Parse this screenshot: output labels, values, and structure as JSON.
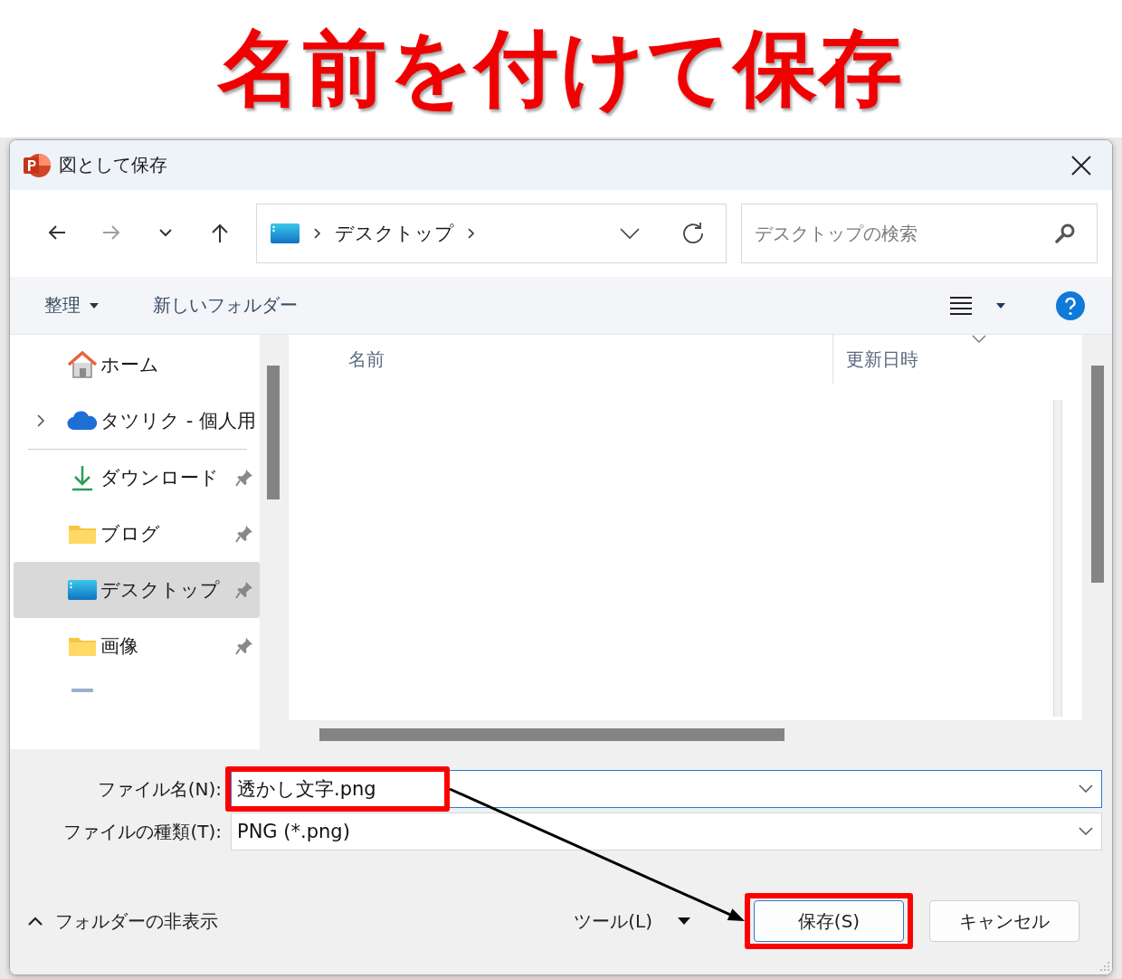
{
  "banner": {
    "title": "名前を付けて保存"
  },
  "window": {
    "title": "図として保存"
  },
  "nav_buttons": [
    {
      "kind": "back",
      "disabled": false
    },
    {
      "kind": "forward",
      "disabled": true
    },
    {
      "kind": "recent",
      "disabled": false
    },
    {
      "kind": "up",
      "disabled": false
    }
  ],
  "address_bar": {
    "segments": [
      "デスクトップ"
    ]
  },
  "search": {
    "placeholder": "デスクトップの検索"
  },
  "command_bar": {
    "organize": "整理",
    "new_folder": "新しいフォルダー"
  },
  "sidebar": {
    "items": [
      {
        "label": "ホーム",
        "kind": "home",
        "pinned": false,
        "selected": false
      },
      {
        "label": "タツリク - 個人用",
        "kind": "cloud",
        "pinned": false,
        "selected": false,
        "expanded": false
      },
      {
        "kind": "divider"
      },
      {
        "label": "ダウンロード",
        "kind": "download",
        "pinned": true,
        "selected": false
      },
      {
        "label": "ブログ",
        "kind": "folder",
        "pinned": true,
        "selected": false
      },
      {
        "label": "デスクトップ",
        "kind": "desktop",
        "pinned": true,
        "selected": true
      },
      {
        "label": "画像",
        "kind": "folder",
        "pinned": true,
        "selected": false
      }
    ]
  },
  "file_list": {
    "columns": [
      "名前",
      "更新日時"
    ]
  },
  "file_name": {
    "label": "ファイル名(N):",
    "value": "透かし文字.png",
    "highlighted": true
  },
  "file_type": {
    "label": "ファイルの種類(T):",
    "value": "PNG (*.png)"
  },
  "footer": {
    "hide_folders": "フォルダーの非表示",
    "tools": "ツール(L)",
    "buttons": [
      {
        "label": "保存(S)",
        "kind": "primary",
        "highlighted": true
      },
      {
        "label": "キャンセル",
        "kind": "secondary",
        "highlighted": false
      }
    ]
  }
}
